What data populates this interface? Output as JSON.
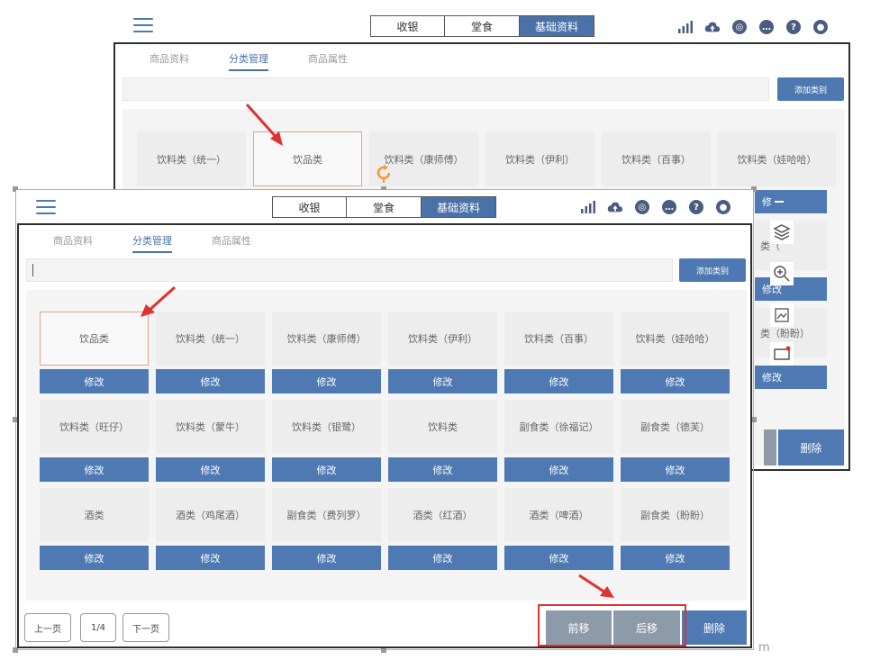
{
  "back_window": {
    "seg_tabs": [
      "收银",
      "堂食",
      "基础资料"
    ],
    "active_seg": 2,
    "tabs": [
      "商品资料",
      "分类管理",
      "商品属性"
    ],
    "active_tab": 1,
    "add_label": "添加类别",
    "cells": [
      "饮料类（统一）",
      "饮品类",
      "饮料类（康师傅）",
      "饮料类（伊利）",
      "饮料类（百事）",
      "饮料类（娃哈哈）"
    ],
    "right_col": [
      "修",
      "类（",
      "修改",
      "类（盼盼）",
      "修改"
    ],
    "delete_label": "删除"
  },
  "front_window": {
    "seg_tabs": [
      "收银",
      "堂食",
      "基础资料"
    ],
    "active_seg": 2,
    "tabs": [
      "商品资料",
      "分类管理",
      "商品属性"
    ],
    "active_tab": 1,
    "add_label": "添加类别",
    "edit_label": "修改",
    "rows": [
      [
        "饮品类",
        "饮料类（统一）",
        "饮料类（康师傅）",
        "饮料类（伊利）",
        "饮料类（百事）",
        "饮料类（娃哈哈）"
      ],
      [
        "饮料类（旺仔）",
        "饮料类（蒙牛）",
        "饮料类（银鹭）",
        "饮料类",
        "副食类（徐福记）",
        "副食类（德芙）"
      ],
      [
        "酒类",
        "酒类（鸡尾酒）",
        "副食类（费列罗）",
        "酒类（红酒）",
        "酒类（啤酒）",
        "副食类（盼盼）"
      ]
    ],
    "pagination": {
      "prev": "上一页",
      "page": "1/4",
      "next": "下一页"
    },
    "move_forward": "前移",
    "move_back": "后移",
    "delete_label": "删除"
  },
  "watermark_tail": "m",
  "icons": [
    "menu-icon",
    "signal-icon",
    "cloud-icon",
    "settings-icon",
    "chat-icon",
    "help-icon",
    "user-icon"
  ],
  "colors": {
    "primary": "#4e79b3",
    "active_tab": "#4b72a8",
    "highlight": "#e03030",
    "grey_button": "#8c9aa9"
  }
}
